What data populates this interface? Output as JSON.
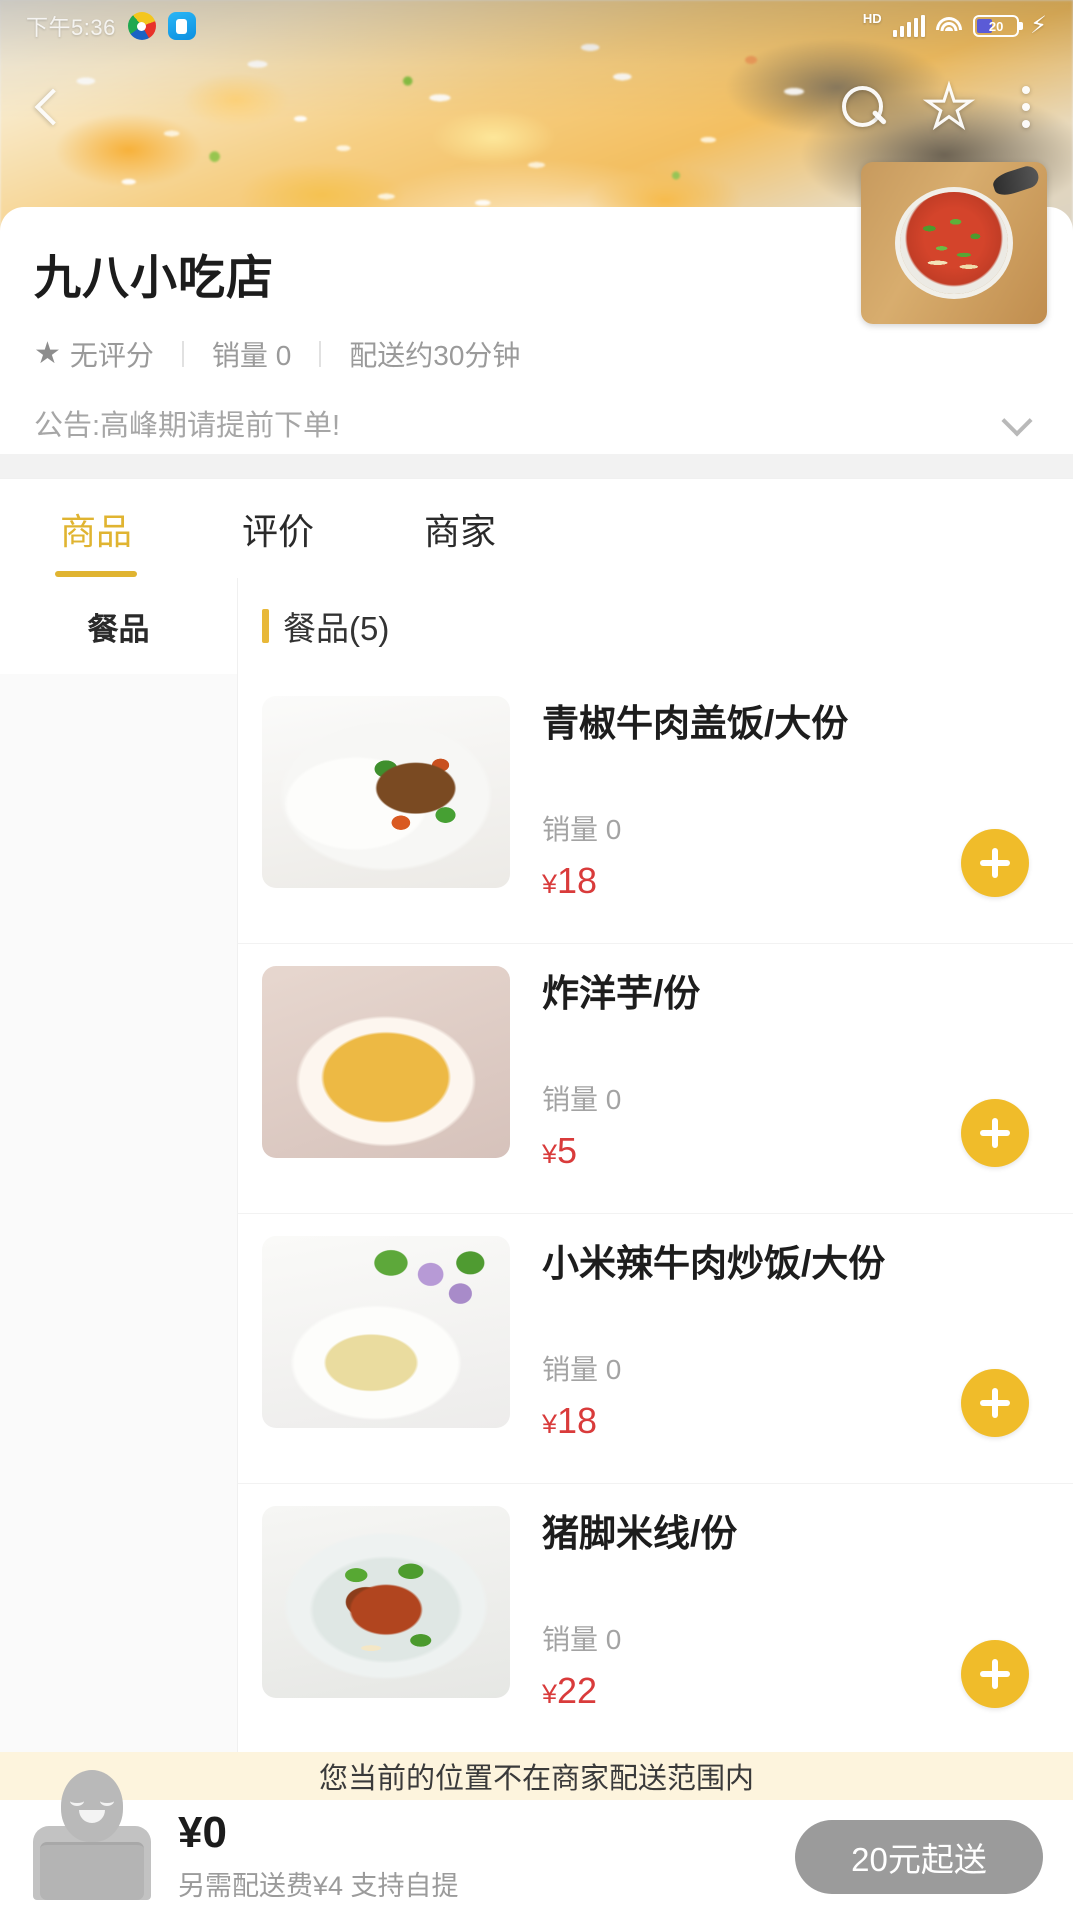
{
  "status_bar": {
    "time": "下午5:36",
    "hd_label": "HD",
    "battery_percent": "20",
    "icons": [
      "app-badge-icon",
      "app-badge-icon",
      "hd-icon",
      "signal-icon",
      "wifi-icon",
      "battery-icon",
      "charging-bolt-icon"
    ]
  },
  "hero_nav": {
    "back_icon": "chevron-left-icon",
    "search_icon": "search-icon",
    "favorite_icon": "star-icon",
    "more_icon": "more-vertical-icon"
  },
  "store": {
    "name": "九八小吃店",
    "rating": "无评分",
    "sales": "销量 0",
    "delivery_time": "配送约30分钟",
    "notice": "公告:高峰期请提前下单!",
    "notice_expand_icon": "chevron-down-icon",
    "avatar_alt": "猪脚米线"
  },
  "tabs": [
    {
      "label": "商品",
      "active": true
    },
    {
      "label": "评价",
      "active": false
    },
    {
      "label": "商家",
      "active": false
    }
  ],
  "categories": [
    {
      "label": "餐品",
      "active": true
    }
  ],
  "section": {
    "title": "餐品(5)"
  },
  "items": [
    {
      "name": "青椒牛肉盖饭/大份",
      "sales": "销量 0",
      "currency": "¥",
      "price": "18",
      "add_icon": "plus-icon"
    },
    {
      "name": "炸洋芋/份",
      "sales": "销量 0",
      "currency": "¥",
      "price": "5",
      "add_icon": "plus-icon"
    },
    {
      "name": "小米辣牛肉炒饭/大份",
      "sales": "销量 0",
      "currency": "¥",
      "price": "18",
      "add_icon": "plus-icon"
    },
    {
      "name": "猪脚米线/份",
      "sales": "销量 0",
      "currency": "¥",
      "price": "22",
      "add_icon": "plus-icon"
    }
  ],
  "warning": {
    "text": "您当前的位置不在商家配送范围内"
  },
  "cart": {
    "rider_icon": "delivery-rider-icon",
    "total": "¥0",
    "fee_note": "另需配送费¥4 支持自提",
    "order_button": "20元起送"
  },
  "colors": {
    "accent": "#e0b431",
    "add_button": "#f0bc2a",
    "price": "#d93b3b",
    "warning_bg": "#fdf4dd",
    "order_button_disabled": "#9b9b9b"
  }
}
